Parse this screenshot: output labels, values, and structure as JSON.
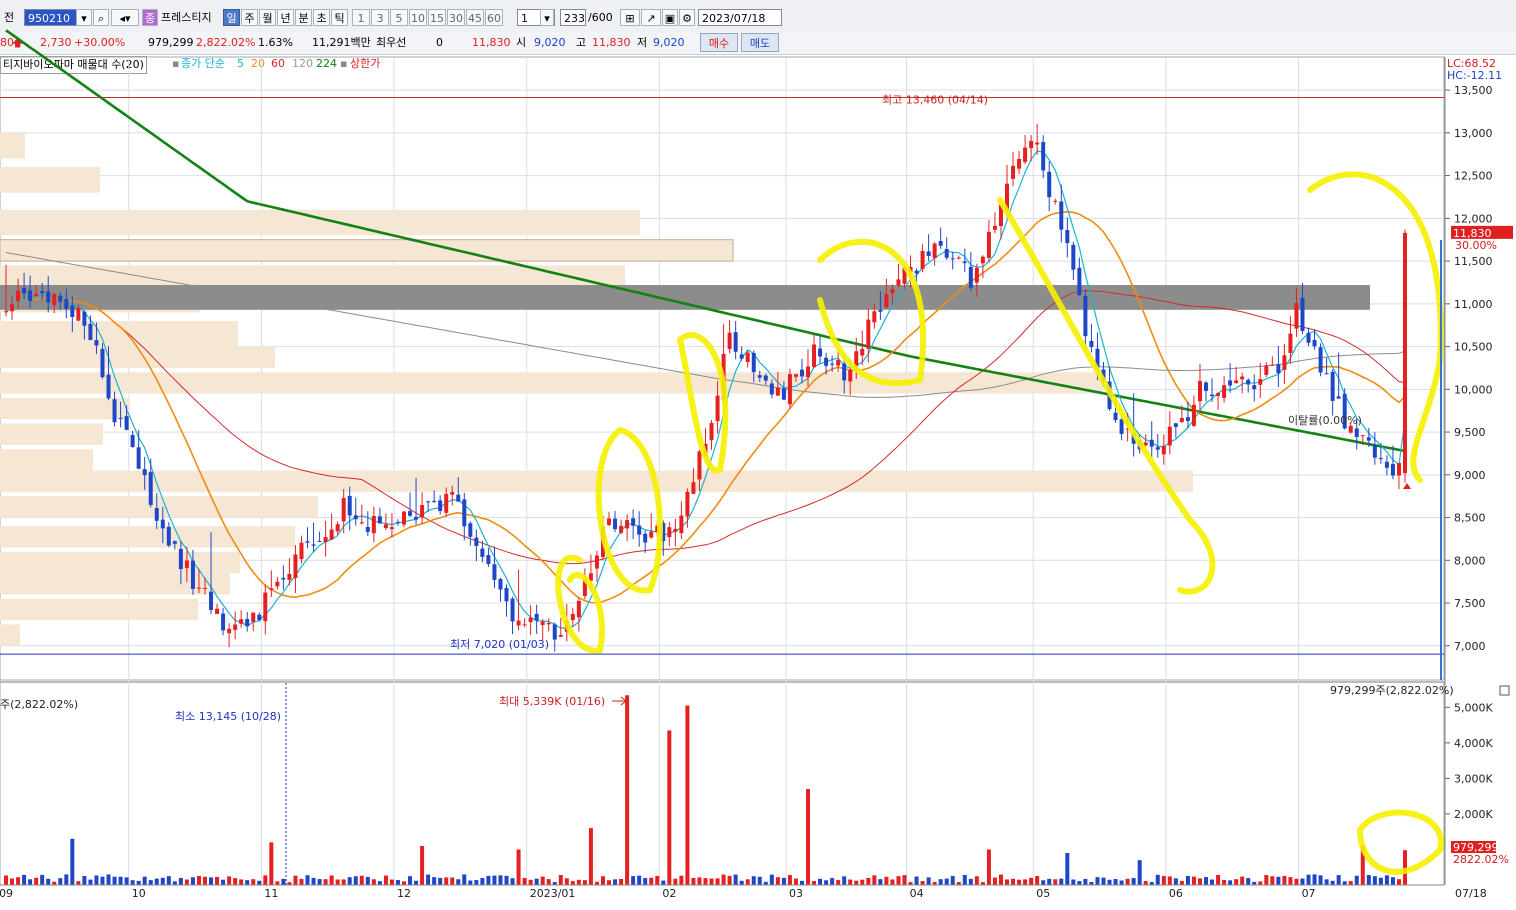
{
  "toolbar": {
    "prefix": "전",
    "code": "950210",
    "name": "프레스티지",
    "periods": [
      "일",
      "주",
      "월",
      "년",
      "분",
      "초",
      "틱"
    ],
    "active_period": "일",
    "minute_options": [
      "1",
      "3",
      "5",
      "10",
      "15",
      "30",
      "45",
      "60"
    ],
    "multiplier": "1",
    "count": "233",
    "count_max": "/600",
    "date": "2023/07/18"
  },
  "quote": {
    "prev_fragment": "80",
    "change": "2,730",
    "change_pct": "+30.00%",
    "volume": "979,299",
    "volume_pct": "2,822.02%",
    "turnover_pct": "1.63%",
    "amount": "11,291백만",
    "priority_label": "최우선",
    "priority_value": "0",
    "current": "11,830",
    "open_label": "시",
    "open": "9,020",
    "high_label": "고",
    "high": "11,830",
    "low_label": "저",
    "low": "9,020",
    "buy": "매수",
    "sell": "매도"
  },
  "legend": {
    "indicator": "티지바이오파마 매물대 수(20)",
    "ma_label": "종가 단순",
    "ma5": "5",
    "ma20": "20",
    "ma60": "60",
    "ma120": "120",
    "ma224": "224",
    "limit_up": "상한가"
  },
  "colors": {
    "up": "#e62020",
    "down": "#1e46c8",
    "ma5": "#19b4d2",
    "ma20": "#f08c10",
    "ma60": "#d62a2a",
    "ma120": "#8c8c8c",
    "ma224": "#148214",
    "volume_profile": "#f6e6d4",
    "highlight_band": "#8c8c8c",
    "annotation": "#f5f000"
  },
  "chart_data": {
    "type": "candlestick",
    "price_axis": {
      "ticks": [
        "13,500",
        "13,000",
        "12,500",
        "12,000",
        "11,500",
        "11,000",
        "10,500",
        "10,000",
        "9,500",
        "9,000",
        "8,500",
        "8,000",
        "7,500",
        "7,000"
      ],
      "ylim": [
        6600,
        13700
      ]
    },
    "lc_label": "LC:68.52",
    "hc_label": "HC:-12.11",
    "x_labels": [
      "09",
      "10",
      "11",
      "12",
      "2023/01",
      "02",
      "03",
      "04",
      "05",
      "06",
      "07"
    ],
    "last_date": "07/18",
    "high_marker": "최고 13,460 (04/14)",
    "high_value": 13460,
    "low_marker": "최저 7,020 (01/03)",
    "low_value": 7020,
    "current_price_label": "11,830",
    "current_pct_label": "30.00%",
    "current_price": 11830,
    "ma_crossing_note": "이탈률(0.00%)",
    "series": [
      {
        "name": "5",
        "role": "ma5"
      },
      {
        "name": "20",
        "role": "ma20"
      },
      {
        "name": "60",
        "role": "ma60"
      },
      {
        "name": "120",
        "role": "ma120"
      },
      {
        "name": "224",
        "role": "ma224"
      }
    ],
    "volume_axis": {
      "ticks": [
        "5,000K",
        "4,000K",
        "3,000K",
        "2,000K"
      ],
      "ylim": [
        0,
        5600
      ]
    },
    "volume_top_left": "주(2,822.02%)",
    "volume_top_right": "979,299주(2,822.02%)",
    "volume_min_marker": "최소 13,145 (10/28)",
    "volume_max_marker": "최대 5,339K (01/16)",
    "volume_max": 5339,
    "last_volume_label": "979,299",
    "last_volume_pct": "2822.02%",
    "last_volume": 979
  }
}
